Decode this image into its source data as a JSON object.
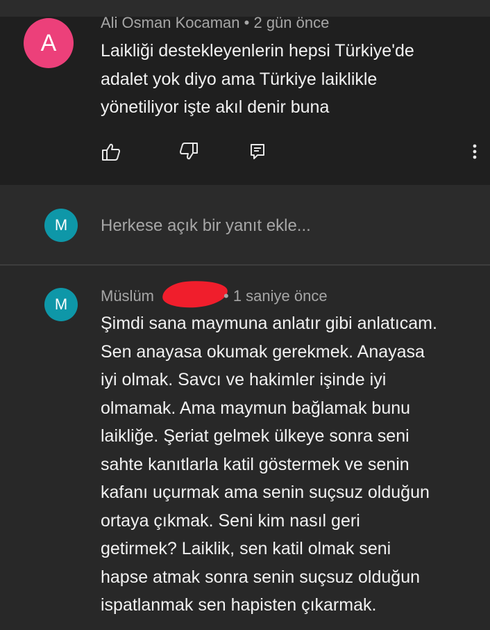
{
  "first_comment": {
    "avatar_letter": "A",
    "avatar_color": "#ec407a",
    "author": "Ali Osman Kocaman",
    "separator": " • ",
    "time": "2 gün önce",
    "lines": [
      "Laikliği destekleyenlerin hepsi Türkiye'de",
      "adalet yok diyo ama Türkiye laiklikle",
      "yönetiliyor işte akıl denir buna"
    ],
    "actions": {
      "like_icon": "thumbs-up-icon",
      "dislike_icon": "thumbs-down-icon",
      "reply_icon": "reply-icon",
      "more_icon": "more-vert-icon"
    }
  },
  "reply_input": {
    "avatar_letter": "M",
    "avatar_color": "#0e97a8",
    "placeholder": "Herkese açık bir yanıt ekle..."
  },
  "second_comment": {
    "avatar_letter": "M",
    "author": "Müslüm",
    "separator": "• ",
    "time": "1 saniye önce",
    "lines": [
      "Şimdi sana maymuna anlatır gibi anlatıcam.",
      "Sen anayasa okumak gerekmek. Anayasa",
      "iyi olmak. Savcı ve hakimler işinde iyi",
      "olmamak. Ama maymun bağlamak bunu",
      "laikliğe. Şeriat gelmek ülkeye sonra seni",
      "sahte kanıtlarla katil göstermek ve senin",
      "kafanı uçurmak ama senin suçsuz olduğun",
      "ortaya çıkmak. Seni kim nasıl geri",
      "getirmek? Laiklik, sen katil olmak seni",
      "hapse atmak sonra senin suçsuz olduğun",
      "ispatlanmak sen hapisten çıkarmak."
    ]
  }
}
